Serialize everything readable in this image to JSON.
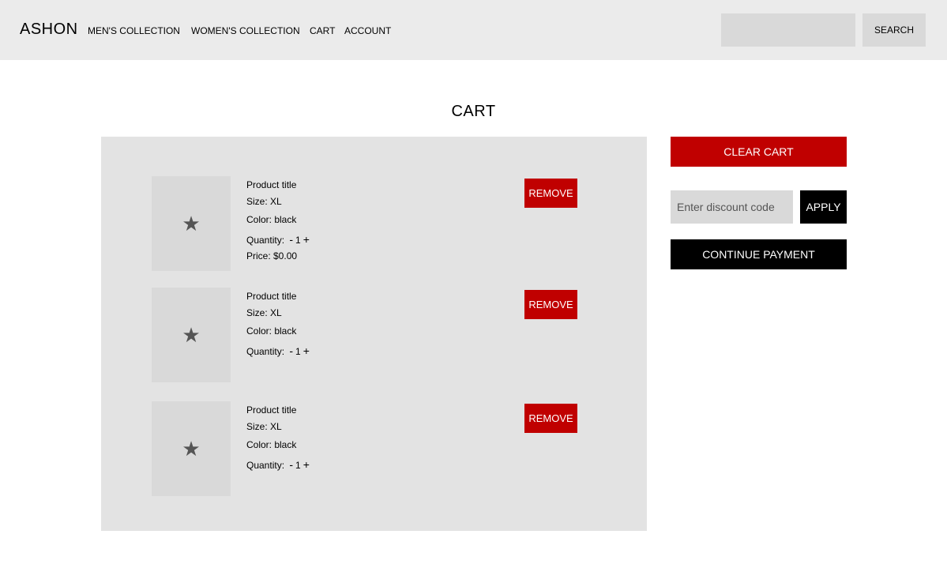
{
  "header": {
    "logo": "ASHON",
    "nav": [
      "MEN'S COLLECTION",
      "WOMEN'S COLLECTION",
      "CART",
      "ACCOUNT"
    ],
    "search_placeholder": "",
    "search_button": "SEARCH"
  },
  "page_title": "CART",
  "cart": {
    "items": [
      {
        "title": "Product title",
        "size": "Size: XL",
        "color": "Color: black",
        "quantity_label": "Quantity:",
        "quantity": "1",
        "price": "Price: $0.00",
        "remove_label": "REMOVE",
        "image_icon": "star-icon"
      },
      {
        "title": "Product title",
        "size": "Size: XL",
        "color": "Color: black",
        "quantity_label": "Quantity:",
        "quantity": "1",
        "price": "",
        "remove_label": "REMOVE",
        "image_icon": "star-icon"
      },
      {
        "title": "Product title",
        "size": "Size: XL",
        "color": "Color: black",
        "quantity_label": "Quantity:",
        "quantity": "1",
        "price": "",
        "remove_label": "REMOVE",
        "image_icon": "star-icon"
      }
    ]
  },
  "sidebar": {
    "clear_cart": "CLEAR CART",
    "discount_placeholder": "Enter discount code",
    "apply": "APPLY",
    "continue_payment": "CONTINUE PAYMENT"
  },
  "colors": {
    "nav_bg": "#ebebeb",
    "panel_bg": "#e3e3e3",
    "accent_red": "#c00000",
    "dark": "#000000"
  },
  "glyphs": {
    "star": "★",
    "minus": "-",
    "plus": "+"
  }
}
